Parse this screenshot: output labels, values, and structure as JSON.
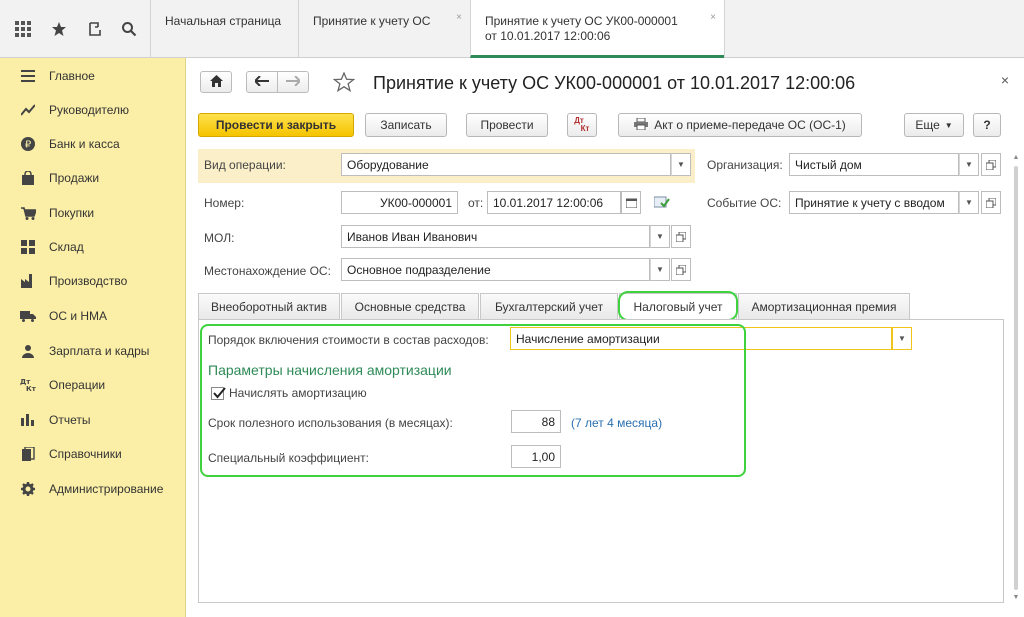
{
  "topbar": {
    "icons": [
      "apps-grid-icon",
      "star-icon",
      "history-icon",
      "search-icon"
    ],
    "tabs": [
      {
        "label": "Начальная страница"
      },
      {
        "label": "Принятие к учету ОС"
      },
      {
        "label_line1": "Принятие к учету ОС УК00-000001",
        "label_line2": "от 10.01.2017 12:00:06"
      }
    ],
    "tab_close": "×"
  },
  "sidebar": {
    "items": [
      {
        "label": "Главное",
        "icon": "menu-lines-icon"
      },
      {
        "label": "Руководителю",
        "icon": "trend-chart-icon"
      },
      {
        "label": "Банк и касса",
        "icon": "ruble-coin-icon"
      },
      {
        "label": "Продажи",
        "icon": "shopping-bag-icon"
      },
      {
        "label": "Покупки",
        "icon": "cart-icon"
      },
      {
        "label": "Склад",
        "icon": "warehouse-grid-icon"
      },
      {
        "label": "Производство",
        "icon": "factory-icon"
      },
      {
        "label": "ОС и НМА",
        "icon": "truck-icon"
      },
      {
        "label": "Зарплата и кадры",
        "icon": "people-icon"
      },
      {
        "label": "Операции",
        "icon": "dt-kt-icon"
      },
      {
        "label": "Отчеты",
        "icon": "bar-chart-icon"
      },
      {
        "label": "Справочники",
        "icon": "books-icon"
      },
      {
        "label": "Администрирование",
        "icon": "gear-icon"
      }
    ]
  },
  "form": {
    "title": "Принятие к учету ОС УК00-000001 от 10.01.2017 12:00:06",
    "close": "×",
    "buttons": {
      "post_close": "Провести и закрыть",
      "save": "Записать",
      "post": "Провести",
      "act": "Акт о приеме-передаче ОС (ОС-1)",
      "more": "Еще",
      "help": "?",
      "dtkt_top": "Дт",
      "dtkt_bottom": "Кт"
    },
    "fields": {
      "operation_label": "Вид операции:",
      "operation_value": "Оборудование",
      "org_label": "Организация:",
      "org_value": "Чистый дом",
      "number_label": "Номер:",
      "number_value": "УК00-000001",
      "date_label": "от:",
      "date_value": "10.01.2017 12:00:06",
      "event_label": "Событие ОС:",
      "event_value": "Принятие к учету с вводом",
      "mol_label": "МОЛ:",
      "mol_value": "Иванов Иван Иванович",
      "location_label": "Местонахождение ОС:",
      "location_value": "Основное подразделение"
    },
    "tabs": [
      {
        "label": "Внеоборотный актив"
      },
      {
        "label": "Основные средства"
      },
      {
        "label": "Бухгалтерский учет"
      },
      {
        "label": "Налоговый учет",
        "active": true
      },
      {
        "label": "Амортизационная премия"
      }
    ],
    "tax": {
      "expense_order_label": "Порядок включения стоимости в состав расходов:",
      "expense_order_value": "Начисление амортизации",
      "section_title": "Параметры начисления амортизации",
      "accrue_label": "Начислять амортизацию",
      "accrue_checked": true,
      "useful_life_label": "Срок полезного использования (в месяцах):",
      "useful_life_value": "88",
      "useful_life_hint": "(7 лет 4 месяца)",
      "coef_label": "Специальный коэффициент:",
      "coef_value": "1,00"
    }
  },
  "colors": {
    "sidebar_bg": "#fbefa7",
    "primary_button": "#f5c400",
    "highlight_green": "#3fd23f",
    "section_title": "#2e8b57",
    "hint_blue": "#2a6fb0"
  }
}
